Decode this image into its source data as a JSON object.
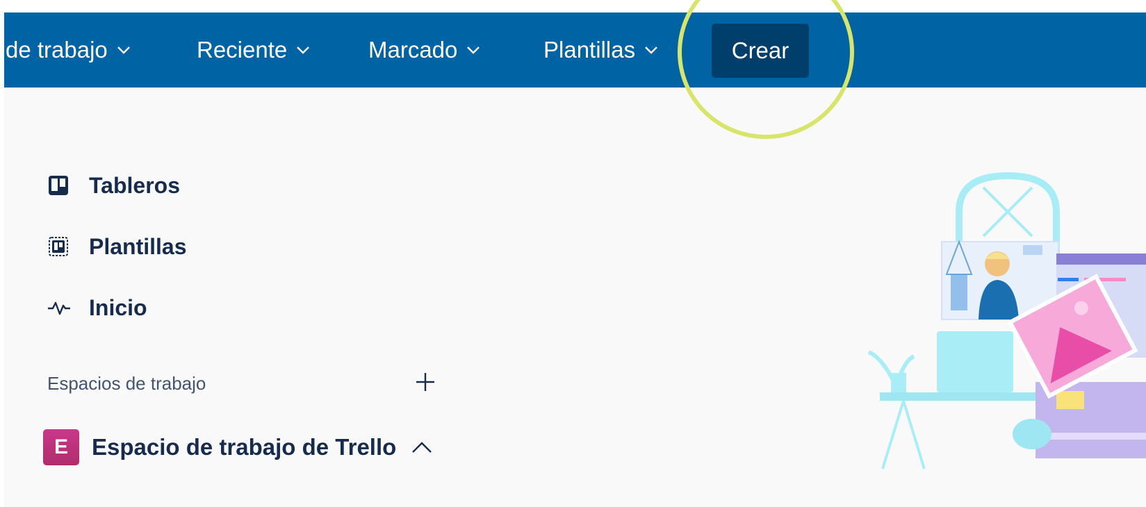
{
  "nav": {
    "items": [
      {
        "label": "de trabajo"
      },
      {
        "label": "Reciente"
      },
      {
        "label": "Marcado"
      },
      {
        "label": "Plantillas"
      }
    ],
    "create_label": "Crear",
    "icons": {
      "dropdown": "chevron-down-icon"
    }
  },
  "sidebar": {
    "items": [
      {
        "label": "Tableros",
        "icon": "boards-icon"
      },
      {
        "label": "Plantillas",
        "icon": "templates-icon"
      },
      {
        "label": "Inicio",
        "icon": "activity-icon"
      }
    ],
    "workspaces_header": "Espacios de trabajo",
    "add_icon": "plus-icon",
    "workspace": {
      "badge": "E",
      "name": "Espacio de trabajo de Trello",
      "toggle_icon": "chevron-up-icon"
    }
  },
  "colors": {
    "topbar": "#0063a3",
    "create_button": "#003f6b",
    "highlight_ring": "#d8e46a",
    "workspace_badge": "#c9378a",
    "text": "#172b4d"
  }
}
